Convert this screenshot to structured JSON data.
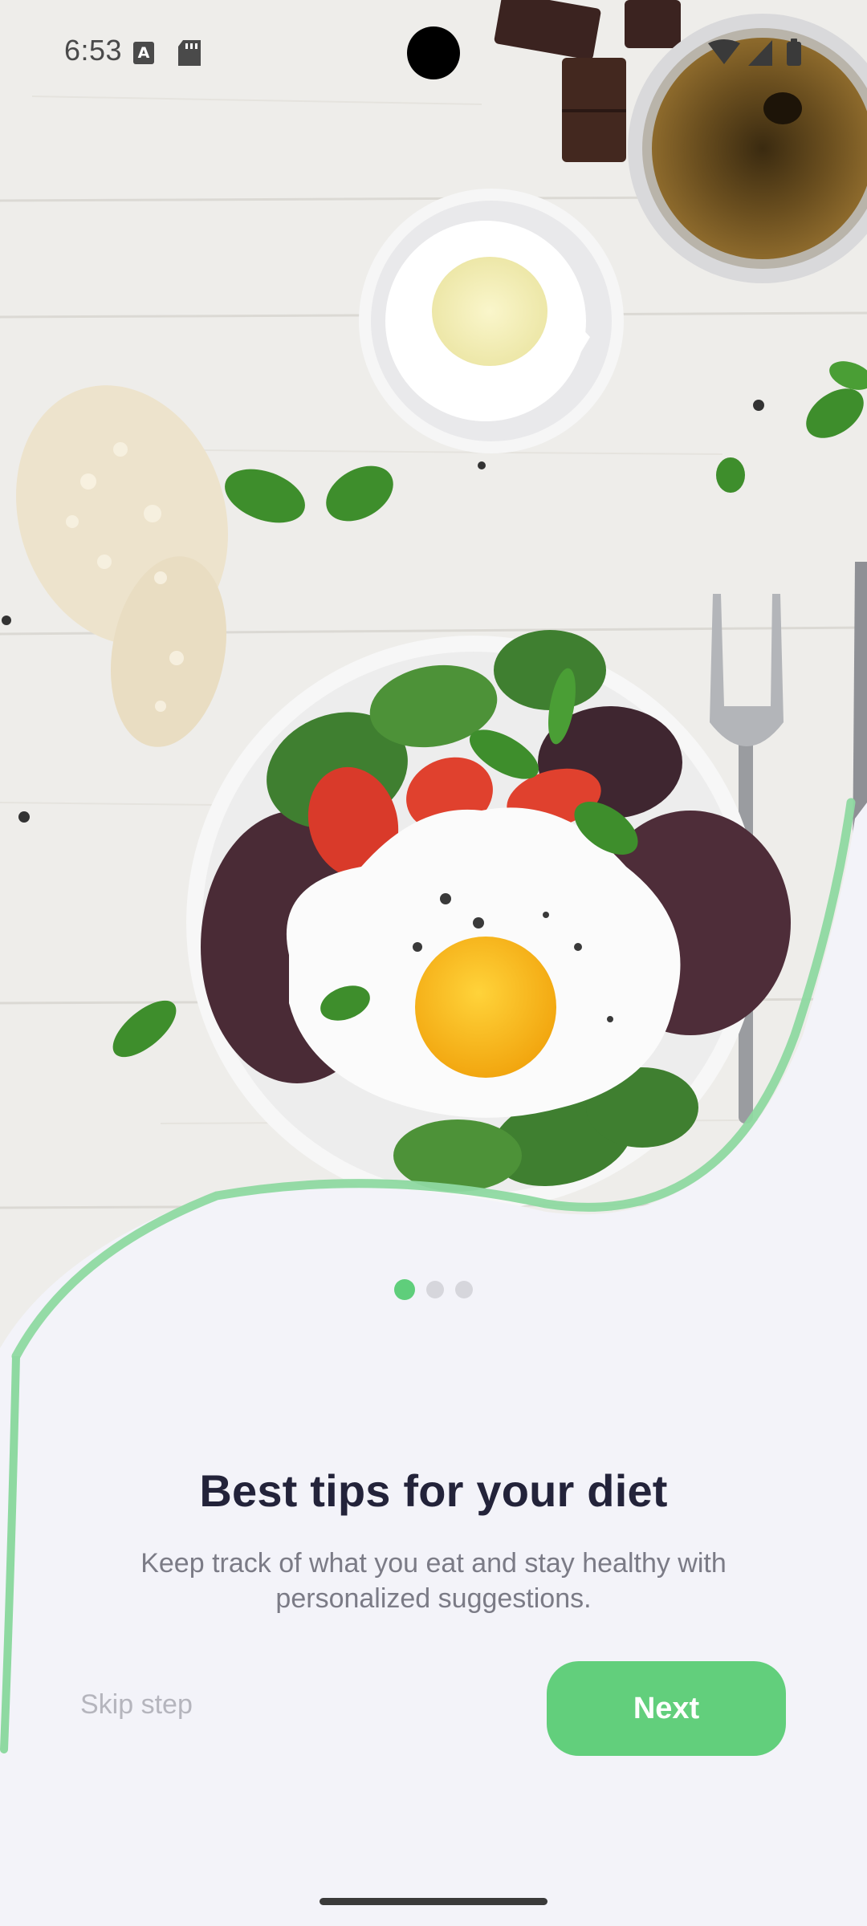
{
  "status_bar": {
    "time": "6:53",
    "keyboard_indicator": "A",
    "icons": [
      "keyboard-a-icon",
      "sd-card-icon",
      "wifi-icon",
      "cellular-signal-icon",
      "battery-icon"
    ]
  },
  "hero": {
    "image_subject": "salad-with-fried-egg-photo"
  },
  "pager": {
    "current_page": 1,
    "total_pages": 3
  },
  "content": {
    "title": "Best tips for your diet",
    "subtitle": "Keep track of what you eat and stay healthy with personalized suggestions."
  },
  "actions": {
    "skip_label": "Skip step",
    "next_label": "Next"
  },
  "colors": {
    "accent": "#62CF7C",
    "title": "#23233A",
    "subtitle": "#7B7B86",
    "skip": "#B5B5BD",
    "background": "#F3F3F9"
  }
}
